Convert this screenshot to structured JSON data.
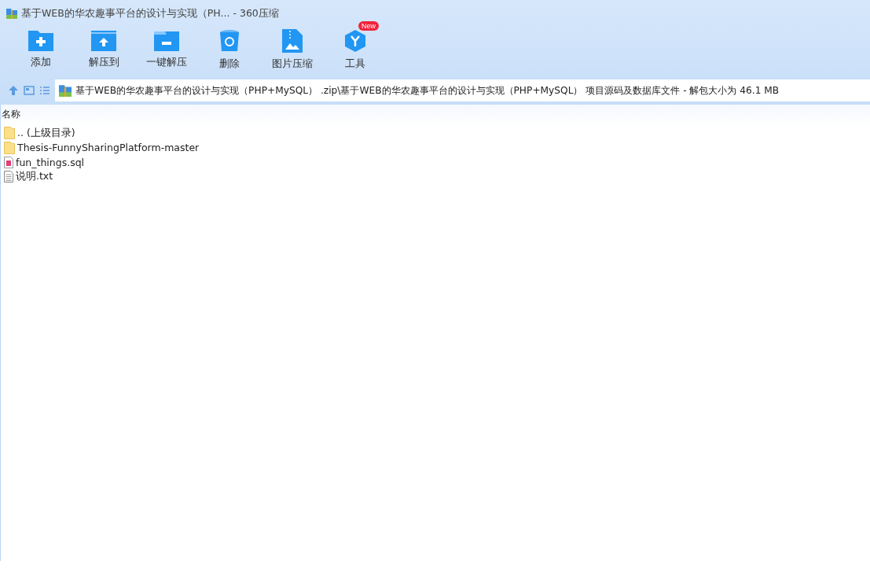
{
  "window": {
    "title": "基于WEB的华农趣事平台的设计与实现（PH... - 360压缩"
  },
  "toolbar": [
    {
      "kind": "add",
      "label": "添加"
    },
    {
      "kind": "extract",
      "label": "解压到"
    },
    {
      "kind": "oneclick",
      "label": "一键解压"
    },
    {
      "kind": "delete",
      "label": "删除"
    },
    {
      "kind": "image",
      "label": "图片压缩"
    },
    {
      "kind": "tools",
      "label": "工具",
      "badge": "New"
    }
  ],
  "address_bar": {
    "path": "基于WEB的华农趣事平台的设计与实现（PHP+MySQL） .zip\\基于WEB的华农趣事平台的设计与实现（PHP+MySQL） 项目源码及数据库文件 - 解包大小为 46.1 MB"
  },
  "table": {
    "columns": [
      "名称"
    ],
    "rows": [
      {
        "kind": "folder",
        "name": ".. (上级目录)"
      },
      {
        "kind": "folder",
        "name": "Thesis-FunnySharingPlatform-master"
      },
      {
        "kind": "sql",
        "name": "fun_things.sql"
      },
      {
        "kind": "txt",
        "name": "说明.txt"
      }
    ]
  }
}
